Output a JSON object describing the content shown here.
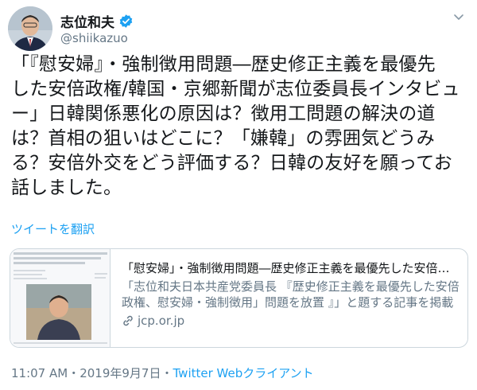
{
  "author": {
    "display_name": "志位和夫",
    "handle": "@shiikazuo",
    "verified": true
  },
  "tweet": {
    "text": "「『慰安婦』・強制徴用問題―歴史修正主義を最優先\nした安倍政権/韓国・京郷新聞が志位委員長インタビュ\nー」日韓関係悪化の原因は？徴用工問題の解決の道\nは？首相の狙いはどこに？「嫌韓」の雰囲気どうみ\nる？安倍外交をどう評価する？日韓の友好を願ってお\n話しました。"
  },
  "translate_label": "ツイートを翻訳",
  "card": {
    "title": "「慰安婦」・強制徴用問題―歴史修正主義を最優先した安倍政権/韓国・京郷新聞が志位委員長インタビュー",
    "description": "「志位和夫日本共産党委員長 『歴史修正主義を最優先した安倍政権、慰安婦・強制徴用」問題を放置 』」と題する記事を掲載しました。",
    "domain": "jcp.or.jp",
    "thumbnail_caption": "\"위안부\" 강제징용 문제 역사수정주의 최우선한 아베 정권 / 시이 위원장 인터뷰"
  },
  "footer": {
    "time": "11:07 AM",
    "separator": "・",
    "date": "2019年9月7日",
    "source": "Twitter Webクライアント"
  },
  "colors": {
    "link_blue": "#1da1f2",
    "muted_gray": "#657786",
    "text_dark": "#14171a",
    "border": "#ccd6dd"
  },
  "icons": {
    "verified": "verified-badge-icon",
    "more": "chevron-down-icon",
    "link": "link-icon"
  }
}
